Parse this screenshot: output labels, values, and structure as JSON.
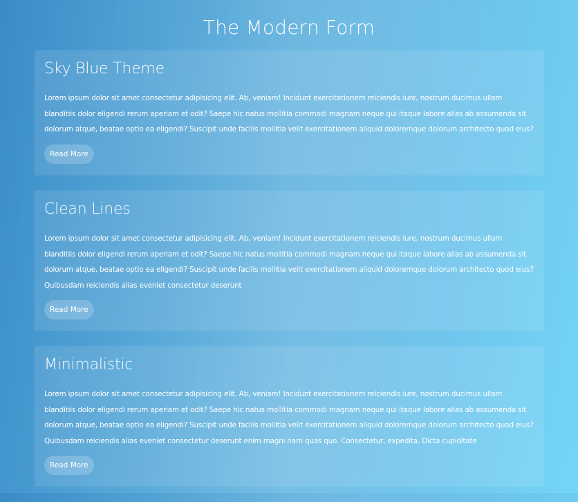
{
  "page": {
    "title": "The Modern Form"
  },
  "cards": [
    {
      "title": "Sky Blue Theme",
      "body": "Lorem ipsum dolor sit amet consectetur adipisicing elit. Ab, veniam! Incidunt exercitationem reiciendis iure, nostrum ducimus ullam blanditiis dolor eligendi rerum aperiam et odit? Saepe hic natus mollitia commodi magnam neque qui itaque labore alias ab assumenda sit dolorum atque, beatae optio ea eligendi? Suscipit unde facilis mollitia velit exercitationem aliquid doloremque dolorum architecto quod eius?",
      "button_label": "Read More"
    },
    {
      "title": "Clean Lines",
      "body": "Lorem ipsum dolor sit amet consectetur adipisicing elit. Ab, veniam! Incidunt exercitationem reiciendis iure, nostrum ducimus ullam blanditiis dolor eligendi rerum aperiam et odit? Saepe hic natus mollitia commodi magnam neque qui itaque labore alias ab assumenda sit dolorum atque, beatae optio ea eligendi? Suscipit unde facilis mollitia velit exercitationem aliquid doloremque dolorum architecto quod eius? Quibusdam reiciendis alias eveniet consectetur deserunt",
      "button_label": "Read More"
    },
    {
      "title": "Minimalistic",
      "body": "Lorem ipsum dolor sit amet consectetur adipisicing elit. Ab, veniam! Incidunt exercitationem reiciendis iure, nostrum ducimus ullam blanditiis dolor eligendi rerum aperiam et odit? Saepe hic natus mollitia commodi magnam neque qui itaque labore alias ab assumenda sit dolorum atque, beatae optio ea eligendi? Suscipit unde facilis mollitia velit exercitationem aliquid doloremque dolorum architecto quod eius? Quibusdam reiciendis alias eveniet consectetur deserunt enim magni nam quas quo. Consectetur, expedita. Dicta cupiditate",
      "button_label": "Read More"
    }
  ],
  "colors": {
    "background_start": "#3a8cc8",
    "background_end": "#74d6f7",
    "text": "#ffffff"
  }
}
